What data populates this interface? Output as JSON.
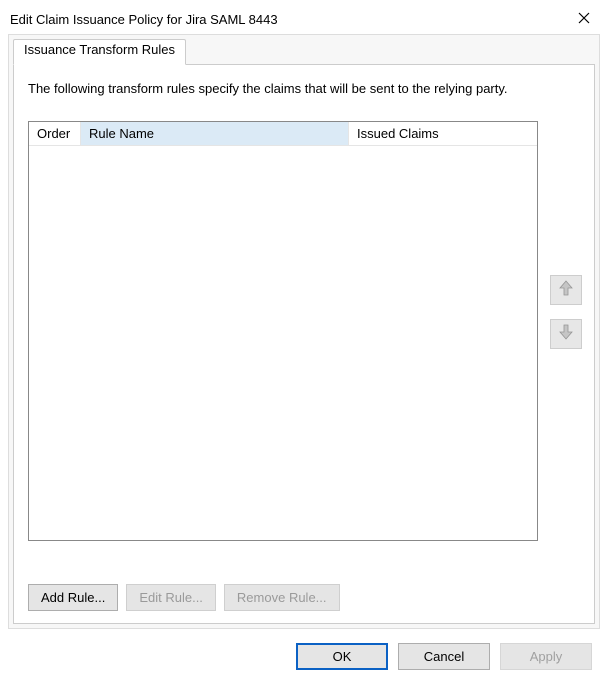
{
  "title": "Edit Claim Issuance Policy for Jira SAML 8443",
  "tabs": {
    "issuance": "Issuance Transform Rules"
  },
  "description": "The following transform rules specify the claims that will be sent to the relying party.",
  "columns": {
    "order": "Order",
    "rule": "Rule Name",
    "claims": "Issued Claims"
  },
  "ruleButtons": {
    "add": "Add Rule...",
    "edit": "Edit Rule...",
    "remove": "Remove Rule..."
  },
  "dialogButtons": {
    "ok": "OK",
    "cancel": "Cancel",
    "apply": "Apply"
  }
}
